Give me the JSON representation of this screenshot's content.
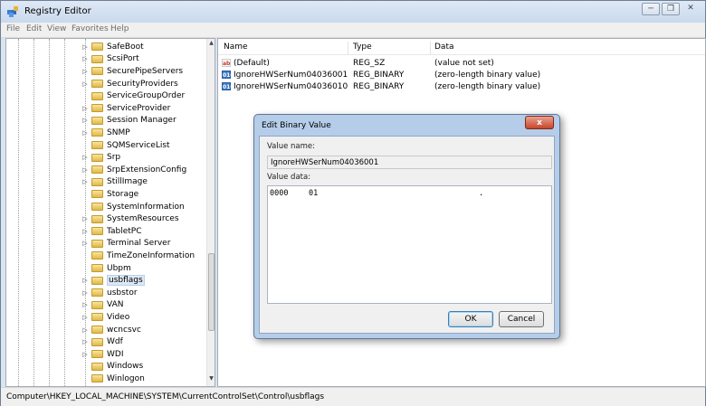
{
  "window": {
    "title": "Registry Editor",
    "buttons": [
      "minimize-button",
      "restore-button",
      "close-button"
    ]
  },
  "menu": [
    "File",
    "Edit",
    "View",
    "Favorites",
    "Help"
  ],
  "tree": [
    {
      "label": "SafeBoot",
      "expandable": true
    },
    {
      "label": "ScsiPort",
      "expandable": true
    },
    {
      "label": "SecurePipeServers",
      "expandable": true
    },
    {
      "label": "SecurityProviders",
      "expandable": true
    },
    {
      "label": "ServiceGroupOrder",
      "expandable": false
    },
    {
      "label": "ServiceProvider",
      "expandable": true
    },
    {
      "label": "Session Manager",
      "expandable": true
    },
    {
      "label": "SNMP",
      "expandable": true
    },
    {
      "label": "SQMServiceList",
      "expandable": false
    },
    {
      "label": "Srp",
      "expandable": true
    },
    {
      "label": "SrpExtensionConfig",
      "expandable": true
    },
    {
      "label": "StillImage",
      "expandable": true
    },
    {
      "label": "Storage",
      "expandable": false
    },
    {
      "label": "SystemInformation",
      "expandable": false
    },
    {
      "label": "SystemResources",
      "expandable": true
    },
    {
      "label": "TabletPC",
      "expandable": true
    },
    {
      "label": "Terminal Server",
      "expandable": true
    },
    {
      "label": "TimeZoneInformation",
      "expandable": false
    },
    {
      "label": "Ubpm",
      "expandable": false
    },
    {
      "label": "usbflags",
      "expandable": true,
      "selected": true
    },
    {
      "label": "usbstor",
      "expandable": true
    },
    {
      "label": "VAN",
      "expandable": true
    },
    {
      "label": "Video",
      "expandable": true
    },
    {
      "label": "wcncsvc",
      "expandable": true
    },
    {
      "label": "Wdf",
      "expandable": true
    },
    {
      "label": "WDI",
      "expandable": true
    },
    {
      "label": "Windows",
      "expandable": false
    },
    {
      "label": "Winlogon",
      "expandable": false
    }
  ],
  "values": {
    "headers": {
      "name": "Name",
      "type": "Type",
      "data": "Data"
    },
    "rows": [
      {
        "icon": "ab",
        "name": "(Default)",
        "type": "REG_SZ",
        "data": "(value not set)"
      },
      {
        "icon": "010",
        "name": "IgnoreHWSerNum04036001",
        "type": "REG_BINARY",
        "data": "(zero-length binary value)"
      },
      {
        "icon": "010",
        "name": "IgnoreHWSerNum04036010",
        "type": "REG_BINARY",
        "data": "(zero-length binary value)"
      }
    ]
  },
  "status": "Computer\\HKEY_LOCAL_MACHINE\\SYSTEM\\CurrentControlSet\\Control\\usbflags",
  "dialog": {
    "title": "Edit Binary Value",
    "close_label": "x",
    "value_name_label": "Value name:",
    "value_name": "IgnoreHWSerNum04036001",
    "value_data_label": "Value data:",
    "hex_offset": "0000",
    "hex_bytes": "01",
    "hex_ascii": ".",
    "ok_label": "OK",
    "cancel_label": "Cancel"
  }
}
